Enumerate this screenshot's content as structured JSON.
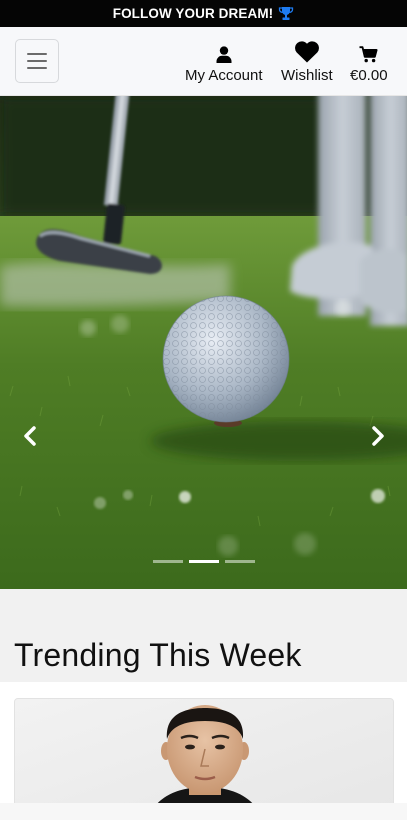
{
  "promo": {
    "text": "FOLLOW YOUR DREAM!",
    "icon": "trophy-icon",
    "icon_color": "#1e7cf2"
  },
  "header": {
    "menu_icon": "hamburger-icon",
    "account": {
      "label": "My Account",
      "icon": "user-icon"
    },
    "wishlist": {
      "label": "Wishlist",
      "icon": "heart-icon"
    },
    "cart": {
      "label": "€0.00",
      "icon": "cart-icon"
    }
  },
  "carousel": {
    "slide_image": "golf-ball-on-tee-photo",
    "prev_icon": "chevron-left-icon",
    "next_icon": "chevron-right-icon",
    "slide_count": 3,
    "active_index": 1
  },
  "trending": {
    "title": "Trending This Week"
  },
  "products": [
    {
      "image": "man-in-black-hoodie-photo"
    }
  ],
  "colors": {
    "promo_bg": "#050505",
    "navbar_bg": "#f7f8fa",
    "section_bg": "#f1f1f1"
  }
}
